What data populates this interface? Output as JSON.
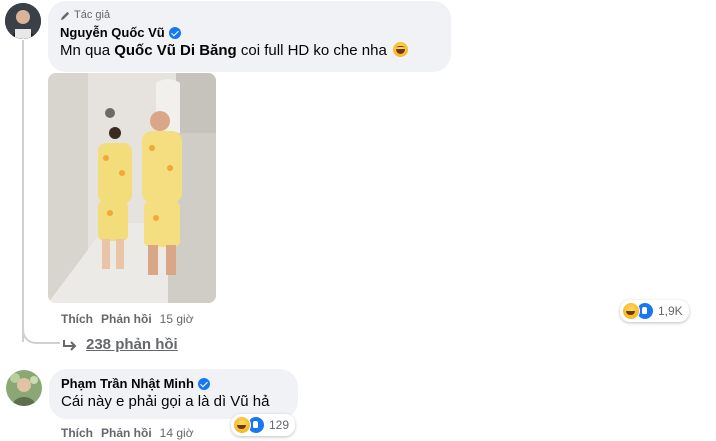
{
  "comment1": {
    "author_tag": "Tác giả",
    "name": "Nguyễn Quốc Vũ",
    "text_prefix": "Mn qua ",
    "text_bold": "Quốc Vũ Di Băng",
    "text_suffix": " coi full HD ko che nha",
    "actions": {
      "like": "Thích",
      "reply": "Phản hồi",
      "time": "15 giờ"
    },
    "reactions": {
      "count": "1,9K",
      "icons": [
        "haha-icon",
        "like-icon"
      ]
    },
    "replies_label": "238 phản hồi"
  },
  "comment2": {
    "name": "Phạm Trần Nhật Minh",
    "text": "Cái này e phải gọi a là dì Vũ hả",
    "actions": {
      "like": "Thích",
      "reply": "Phản hồi",
      "time": "14 giờ"
    },
    "reactions": {
      "count": "129",
      "icons": [
        "haha-icon",
        "like-icon"
      ]
    }
  },
  "colors": {
    "bubble": "#f0f2f5",
    "secondary_text": "#65676b",
    "verified": "#1877f2"
  }
}
